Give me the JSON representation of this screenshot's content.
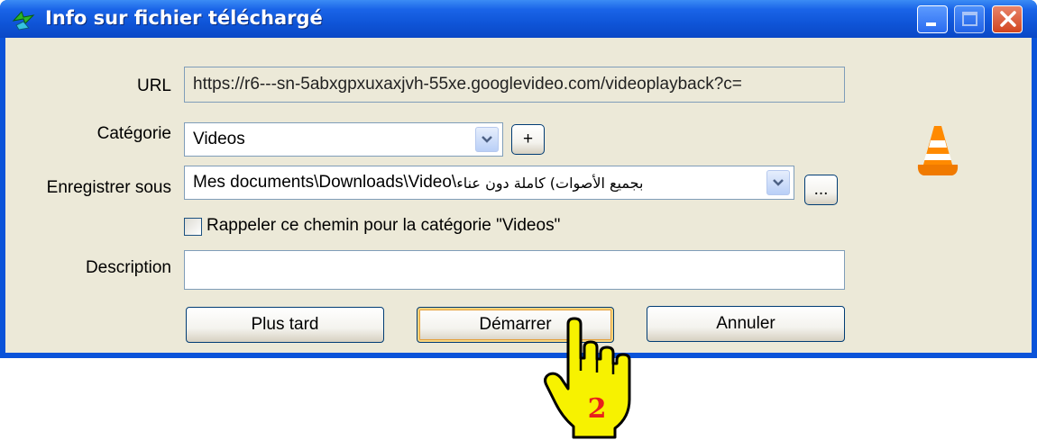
{
  "window": {
    "title": "Info sur fichier téléchargé",
    "controls": [
      "minimize-icon",
      "maximize-icon",
      "close-icon"
    ]
  },
  "form": {
    "url_label": "URL",
    "url_value": "https://r6---sn-5abxgpxuxaxjvh-55xe.googlevideo.com/videoplayback?c=",
    "category_label": "Catégorie",
    "category_value": "Videos",
    "category_add_label": "+",
    "save_as_label": "Enregistrer sous",
    "save_as_path": "Mes documents\\Downloads\\Video\\",
    "save_as_filename": "بجميع الأصوات) كاملة دون عناء",
    "browse_label": "...",
    "remember_label": "Rappeler ce chemin pour la catégorie \"Videos\"",
    "remember_checked": false,
    "description_label": "Description",
    "description_value": ""
  },
  "buttons": {
    "later": "Plus tard",
    "start": "Démarrer",
    "cancel": "Annuler"
  },
  "annotation": {
    "step_number": "2",
    "pointer_icon": "hand-pointer-icon"
  },
  "colors": {
    "titlebar": "#0f55d8",
    "dialog_bg": "#ece9d8",
    "close_button": "#d2451f",
    "hand_fill": "#f7f200",
    "step_number_color": "#e8201c"
  }
}
